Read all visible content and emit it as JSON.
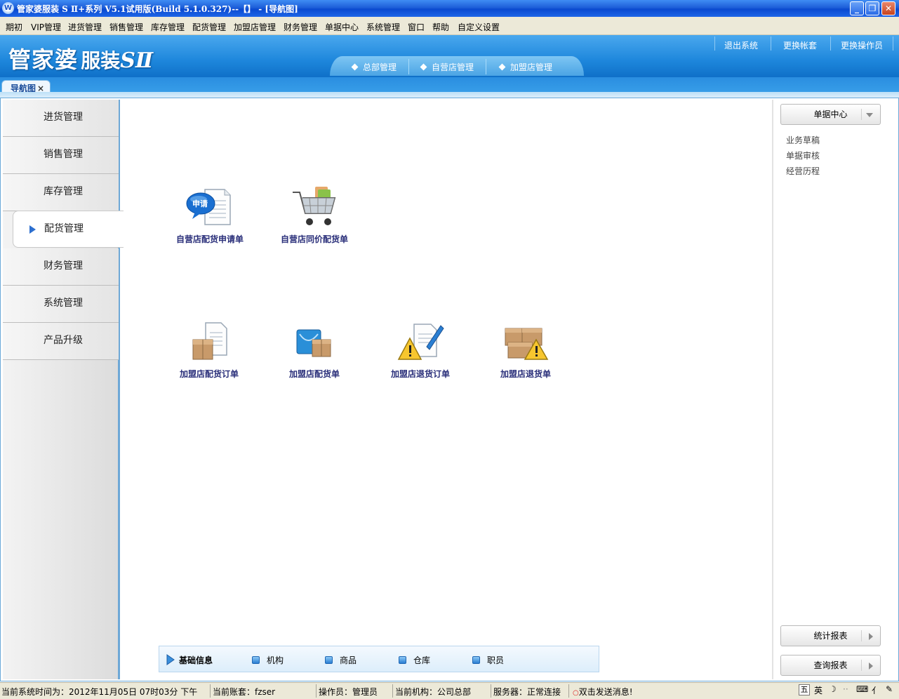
{
  "window": {
    "title": "管家婆服装 S Ⅱ+系列 V5.1试用版(Build 5.1.0.327)--【】 - [导航图]",
    "icon_letter": "W"
  },
  "menubar": [
    "期初",
    "VIP管理",
    "进货管理",
    "销售管理",
    "库存管理",
    "配货管理",
    "加盟店管理",
    "财务管理",
    "单据中心",
    "系统管理",
    "窗口",
    "帮助",
    "自定义设置"
  ],
  "banner": {
    "logo_part1": "管家婆",
    "logo_part2": "服装",
    "logo_part3": "SⅡ",
    "top_links": [
      "退出系统",
      "更换帐套",
      "更换操作员"
    ],
    "module_tabs": [
      "总部管理",
      "自营店管理",
      "加盟店管理"
    ]
  },
  "tabs": {
    "nav_tab": "导航图",
    "close_glyph": "×"
  },
  "leftnav": [
    "进货管理",
    "销售管理",
    "库存管理",
    "配货管理",
    "财务管理",
    "系统管理",
    "产品升级"
  ],
  "active_nav": "配货管理",
  "tiles_row1": [
    "自营店配货申请单",
    "自营店同价配货单"
  ],
  "tiles_row2": [
    "加盟店配货订单",
    "加盟店配货单",
    "加盟店退货订单",
    "加盟店退货单"
  ],
  "tile_badge": "申请",
  "infobar": {
    "title": "基础信息",
    "items": [
      "机构",
      "商品",
      "仓库",
      "职员"
    ]
  },
  "rightpanel": {
    "header_button": "单据中心",
    "links": [
      "业务草稿",
      "单据审核",
      "经营历程"
    ],
    "bottom_buttons": [
      "统计报表",
      "查询报表"
    ]
  },
  "statusbar": {
    "time": "当前系统时间为：2012年11月05日 07时03分 下午",
    "account": "当前账套：fzser",
    "operator": "操作员：管理员",
    "org": "当前机构：公司总部",
    "server": "服务器：正常连接",
    "message": "双击发送消息!",
    "ime_lang": "英"
  },
  "colors": {
    "accent": "#1e87dc",
    "title_bar": "#0a4ad0",
    "tile_caption": "#2a2f7a",
    "active_arrow": "#2d6fcf"
  }
}
